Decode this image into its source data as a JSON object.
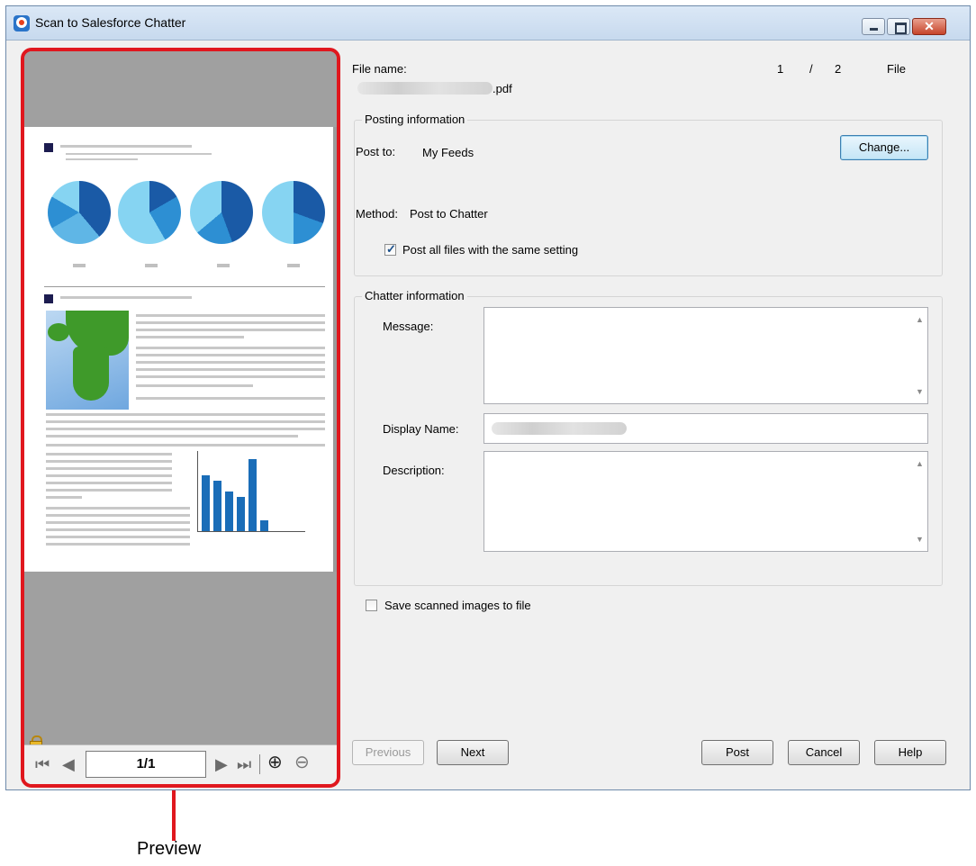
{
  "window": {
    "title": "Scan to Salesforce Chatter",
    "close_glyph": "✕"
  },
  "preview": {
    "page_indicator": "1/1",
    "nav_first": "⏮",
    "nav_prev": "◀",
    "nav_next": "▶",
    "nav_last": "⏭",
    "zoom_in": "⊕",
    "zoom_out": "⊖"
  },
  "file": {
    "label": "File name:",
    "extension": ".pdf",
    "index": "1",
    "separator": "/",
    "total": "2",
    "unit": "File"
  },
  "posting": {
    "title": "Posting information",
    "post_to_label": "Post to:",
    "post_to_value": "My Feeds",
    "change_button": "Change...",
    "method_label": "Method:",
    "method_value": "Post to Chatter",
    "same_setting_label": "Post all files with the same setting",
    "same_setting_checked": true
  },
  "chatter": {
    "title": "Chatter information",
    "message_label": "Message:",
    "message_value": "",
    "display_name_label": "Display Name:",
    "description_label": "Description:",
    "description_value": "",
    "scroll_up": "▲",
    "scroll_down": "▼"
  },
  "options": {
    "save_images_label": "Save scanned images to file",
    "save_images_checked": false
  },
  "buttons": {
    "previous": "Previous",
    "next": "Next",
    "post": "Post",
    "cancel": "Cancel",
    "help": "Help"
  },
  "callout": {
    "label": "Preview"
  }
}
